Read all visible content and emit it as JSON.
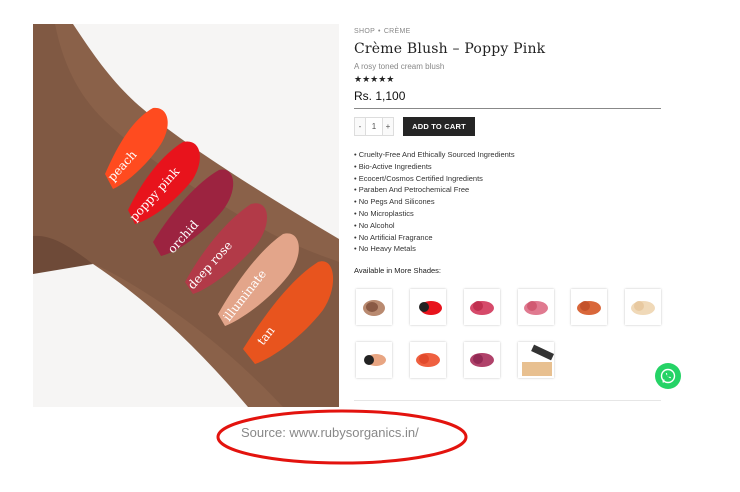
{
  "photo": {
    "swatch_labels": [
      "peach",
      "poppy pink",
      "orchid",
      "deep rose",
      "illuminate",
      "tan"
    ],
    "next_icon": "chevron-right-icon"
  },
  "product": {
    "breadcrumb": [
      "SHOP",
      "CRÈME"
    ],
    "breadcrumb_sep": "•",
    "title": "Crème Blush – Poppy Pink",
    "subtitle": "A rosy toned cream blush",
    "rating": "★★★★★",
    "price": "Rs. 1,100",
    "qty_minus": "-",
    "qty_value": "1",
    "qty_plus": "+",
    "add_to_cart": "ADD TO CART",
    "features": [
      "• Cruelty-Free And Ethically Sourced Ingredients",
      "• Bio-Active Ingredients",
      "• Ecocert/Cosmos Certified Ingredients",
      "• Paraben And Petrochemical Free",
      "• No Pegs And Silicones",
      "• No Microplastics",
      "• No Alcohol",
      "• No Artificial Fragrance",
      "• No Heavy Metals"
    ],
    "shades_heading": "Available in More Shades:"
  },
  "colors": {
    "swatches": [
      "#ff4b1f",
      "#e8131c",
      "#9c2340",
      "#b23a48",
      "#e3a58a",
      "#e8541e"
    ]
  },
  "whatsapp_icon": "whatsapp-icon",
  "source": "Source: www.rubysorganics.in/"
}
